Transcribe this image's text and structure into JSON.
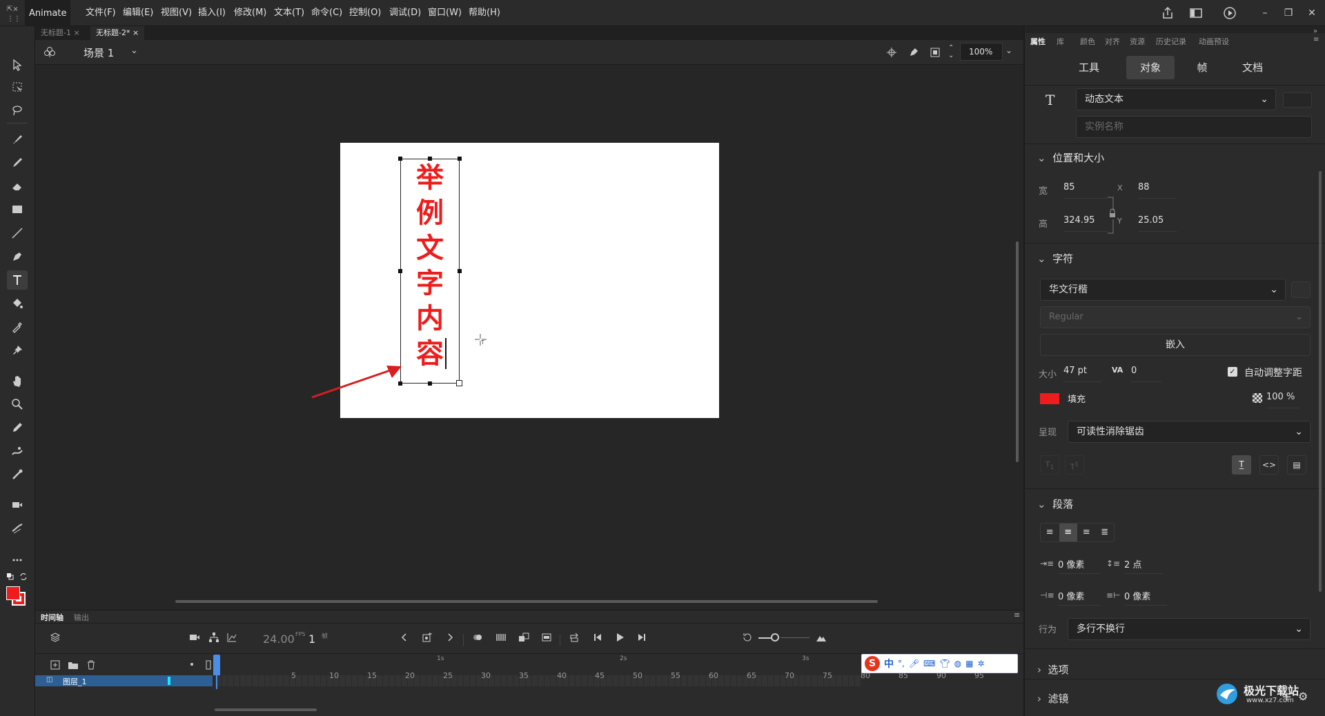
{
  "app": {
    "name": "Animate",
    "menus": [
      "文件(F)",
      "编辑(E)",
      "视图(V)",
      "插入(I)",
      "修改(M)",
      "文本(T)",
      "命令(C)",
      "控制(O)",
      "调试(D)",
      "窗口(W)",
      "帮助(H)"
    ]
  },
  "tabs": [
    {
      "label": "无标题-1",
      "close": "×"
    },
    {
      "label": "无标题-2*",
      "close": "×"
    }
  ],
  "scene": {
    "label": "场景 1",
    "zoom": "100%"
  },
  "stage": {
    "text_lines": [
      "举",
      "例",
      "文",
      "字",
      "内",
      "容"
    ],
    "text_color": "#ee1c1c"
  },
  "right_panel": {
    "top_tabs": [
      "属性",
      "库",
      "颜色",
      "对齐",
      "资源",
      "历史记录",
      "动画预设"
    ],
    "seg_tabs": [
      "工具",
      "对象",
      "帧",
      "文档"
    ],
    "text_type": "动态文本",
    "instance_placeholder": "实例名称",
    "position": {
      "title": "位置和大小",
      "w_label": "宽",
      "w_value": "85",
      "x_label": "X",
      "x_value": "88",
      "h_label": "高",
      "h_value": "324.95",
      "y_label": "Y",
      "y_value": "25.05"
    },
    "character": {
      "title": "字符",
      "font": "华文行楷",
      "style": "Regular",
      "embed": "嵌入",
      "size_label": "大小",
      "size_value": "47 pt",
      "tracking_value": "0",
      "auto_kern": "自动调整字距",
      "fill_label": "填充",
      "fill_color": "#ee1c1c",
      "alpha": "100 %",
      "render_label": "呈现",
      "render_value": "可读性消除锯齿"
    },
    "paragraph": {
      "title": "段落",
      "indent": "0 像素",
      "line_spacing": "2 点",
      "left_margin": "0 像素",
      "right_margin": "0 像素",
      "behavior_label": "行为",
      "behavior_value": "多行不换行"
    },
    "options_title": "选项",
    "filters_title": "滤镜"
  },
  "timeline": {
    "tabs": [
      "时间轴",
      "输出"
    ],
    "fps": "24.00",
    "fps_unit": "FPS",
    "frame": "1",
    "frame_unit": "帧",
    "layer_name": "图层_1",
    "seconds": [
      "1s",
      "2s",
      "3s"
    ],
    "frame_ticks": [
      "5",
      "10",
      "15",
      "20",
      "25",
      "30",
      "35",
      "40",
      "45",
      "50",
      "55",
      "60",
      "65",
      "70",
      "75",
      "80",
      "85",
      "90",
      "95"
    ]
  },
  "ime": {
    "label": "中"
  },
  "watermark": {
    "text": "极光下载站",
    "url": "www.xz7.com"
  }
}
